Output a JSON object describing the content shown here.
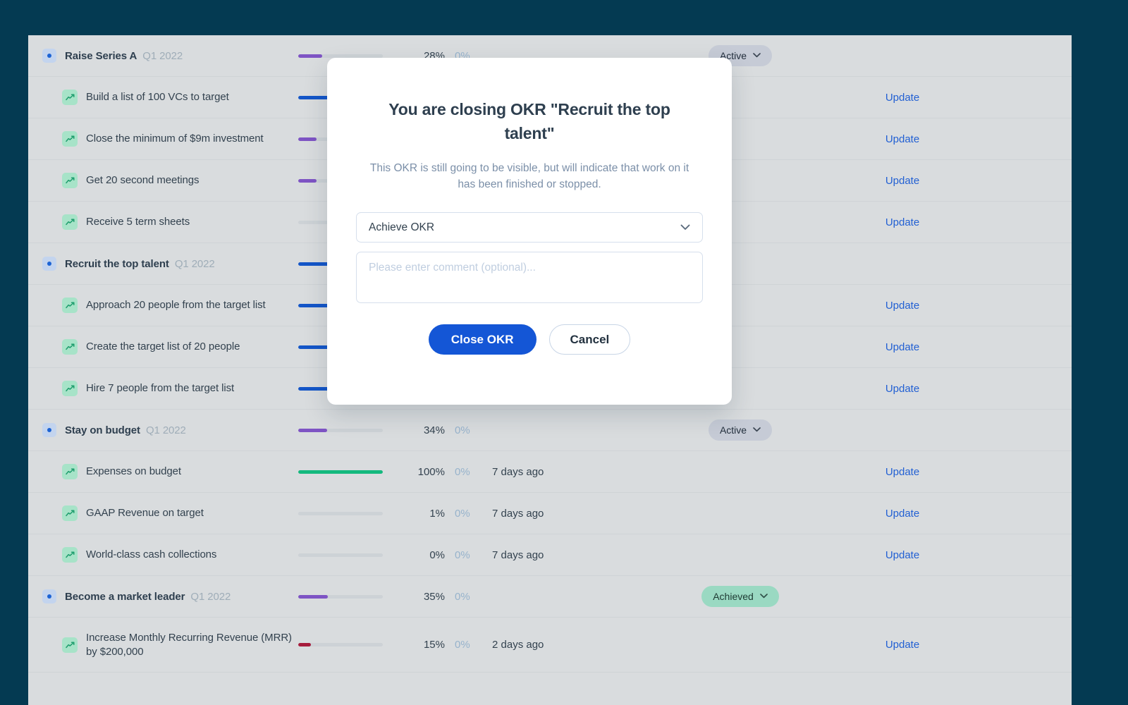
{
  "theme": {
    "page_bg": "#043a52",
    "panel_bg": "#d9dcde",
    "accent_blue": "#1456d6",
    "link_blue": "#2260d3",
    "purple_bar": "#7e54c4",
    "blue_bar": "#1456c8",
    "green_bar": "#14b97e",
    "red_bar": "#a61c3c",
    "empty_bar": "#cdd2d6",
    "badge_active_bg": "#c6cbd6",
    "badge_achieved_bg": "#9ad9c2"
  },
  "rows": [
    {
      "kind": "objective",
      "icon": "objective-dot-icon",
      "title": "Raise Series A",
      "period": "Q1 2022",
      "progress": 28,
      "bar_color": "#7e54c4",
      "percent": "28%",
      "delta": "0%",
      "updated": "",
      "badge": "Active",
      "badge_kind": "active",
      "update": ""
    },
    {
      "kind": "kr",
      "icon": "trend-chart-icon",
      "title": "Build a list of 100 VCs to target",
      "period": "",
      "progress": 100,
      "bar_color": "#1456c8",
      "percent": "",
      "delta": "",
      "updated": "",
      "badge": "",
      "badge_kind": "",
      "update": "Update"
    },
    {
      "kind": "kr",
      "icon": "trend-chart-icon",
      "title": "Close the minimum of $9m investment",
      "period": "",
      "progress": 22,
      "bar_color": "#7e54c4",
      "percent": "",
      "delta": "",
      "updated": "",
      "badge": "",
      "badge_kind": "",
      "update": "Update"
    },
    {
      "kind": "kr",
      "icon": "trend-chart-icon",
      "title": "Get 20 second meetings",
      "period": "",
      "progress": 22,
      "bar_color": "#7e54c4",
      "percent": "",
      "delta": "",
      "updated": "",
      "badge": "",
      "badge_kind": "",
      "update": "Update"
    },
    {
      "kind": "kr",
      "icon": "trend-chart-icon",
      "title": "Receive 5 term sheets",
      "period": "",
      "progress": 0,
      "bar_color": "#cdd2d6",
      "percent": "",
      "delta": "",
      "updated": "",
      "badge": "",
      "badge_kind": "",
      "update": "Update"
    },
    {
      "kind": "objective",
      "icon": "objective-dot-icon",
      "title": "Recruit the top talent",
      "period": "Q1 2022",
      "progress": 100,
      "bar_color": "#1456c8",
      "percent": "",
      "delta": "",
      "updated": "",
      "badge": "",
      "badge_kind": "hidden-active",
      "update": ""
    },
    {
      "kind": "kr",
      "icon": "trend-chart-icon",
      "title": "Approach 20 people from the target list",
      "period": "",
      "progress": 100,
      "bar_color": "#1456c8",
      "percent": "",
      "delta": "",
      "updated": "",
      "badge": "",
      "badge_kind": "",
      "update": "Update"
    },
    {
      "kind": "kr",
      "icon": "trend-chart-icon",
      "title": "Create the target list of 20 people",
      "period": "",
      "progress": 100,
      "bar_color": "#1456c8",
      "percent": "",
      "delta": "",
      "updated": "",
      "badge": "",
      "badge_kind": "",
      "update": "Update"
    },
    {
      "kind": "kr",
      "icon": "trend-chart-icon",
      "title": "Hire 7 people from the target list",
      "period": "",
      "progress": 100,
      "bar_color": "#1456c8",
      "percent": "",
      "delta": "",
      "updated": "",
      "badge": "",
      "badge_kind": "",
      "update": "Update"
    },
    {
      "kind": "objective",
      "icon": "objective-dot-icon",
      "title": "Stay on budget",
      "period": "Q1 2022",
      "progress": 34,
      "bar_color": "#7e54c4",
      "percent": "34%",
      "delta": "0%",
      "updated": "",
      "badge": "Active",
      "badge_kind": "active",
      "update": ""
    },
    {
      "kind": "kr",
      "icon": "trend-chart-icon",
      "title": "Expenses on budget",
      "period": "",
      "progress": 100,
      "bar_color": "#14b97e",
      "percent": "100%",
      "delta": "0%",
      "updated": "7 days ago",
      "badge": "",
      "badge_kind": "",
      "update": "Update"
    },
    {
      "kind": "kr",
      "icon": "trend-chart-icon",
      "title": "GAAP Revenue on target",
      "period": "",
      "progress": 1,
      "bar_color": "#cdd2d6",
      "percent": "1%",
      "delta": "0%",
      "updated": "7 days ago",
      "badge": "",
      "badge_kind": "",
      "update": "Update"
    },
    {
      "kind": "kr",
      "icon": "trend-chart-icon",
      "title": "World-class cash collections",
      "period": "",
      "progress": 0,
      "bar_color": "#cdd2d6",
      "percent": "0%",
      "delta": "0%",
      "updated": "7 days ago",
      "badge": "",
      "badge_kind": "",
      "update": "Update"
    },
    {
      "kind": "objective",
      "icon": "objective-dot-icon",
      "title": "Become a market leader",
      "period": "Q1 2022",
      "progress": 35,
      "bar_color": "#7e54c4",
      "percent": "35%",
      "delta": "0%",
      "updated": "",
      "badge": "Achieved",
      "badge_kind": "achieved",
      "update": ""
    },
    {
      "kind": "kr",
      "icon": "trend-chart-icon",
      "title": "Increase Monthly Recurring Revenue (MRR) by $200,000",
      "period": "",
      "progress": 15,
      "bar_color": "#a61c3c",
      "percent": "15%",
      "delta": "0%",
      "updated": "2 days ago",
      "badge": "",
      "badge_kind": "",
      "update": "Update"
    }
  ],
  "modal": {
    "title": "You are closing OKR \"Recruit the top talent\"",
    "description": "This OKR is still going to be visible, but will indicate that work on it has been finished or stopped.",
    "select_value": "Achieve OKR",
    "select_options": [
      "Achieve OKR"
    ],
    "comment_placeholder": "Please enter comment (optional)...",
    "comment_value": "",
    "primary_button": "Close OKR",
    "secondary_button": "Cancel",
    "chevron": "⌄"
  }
}
